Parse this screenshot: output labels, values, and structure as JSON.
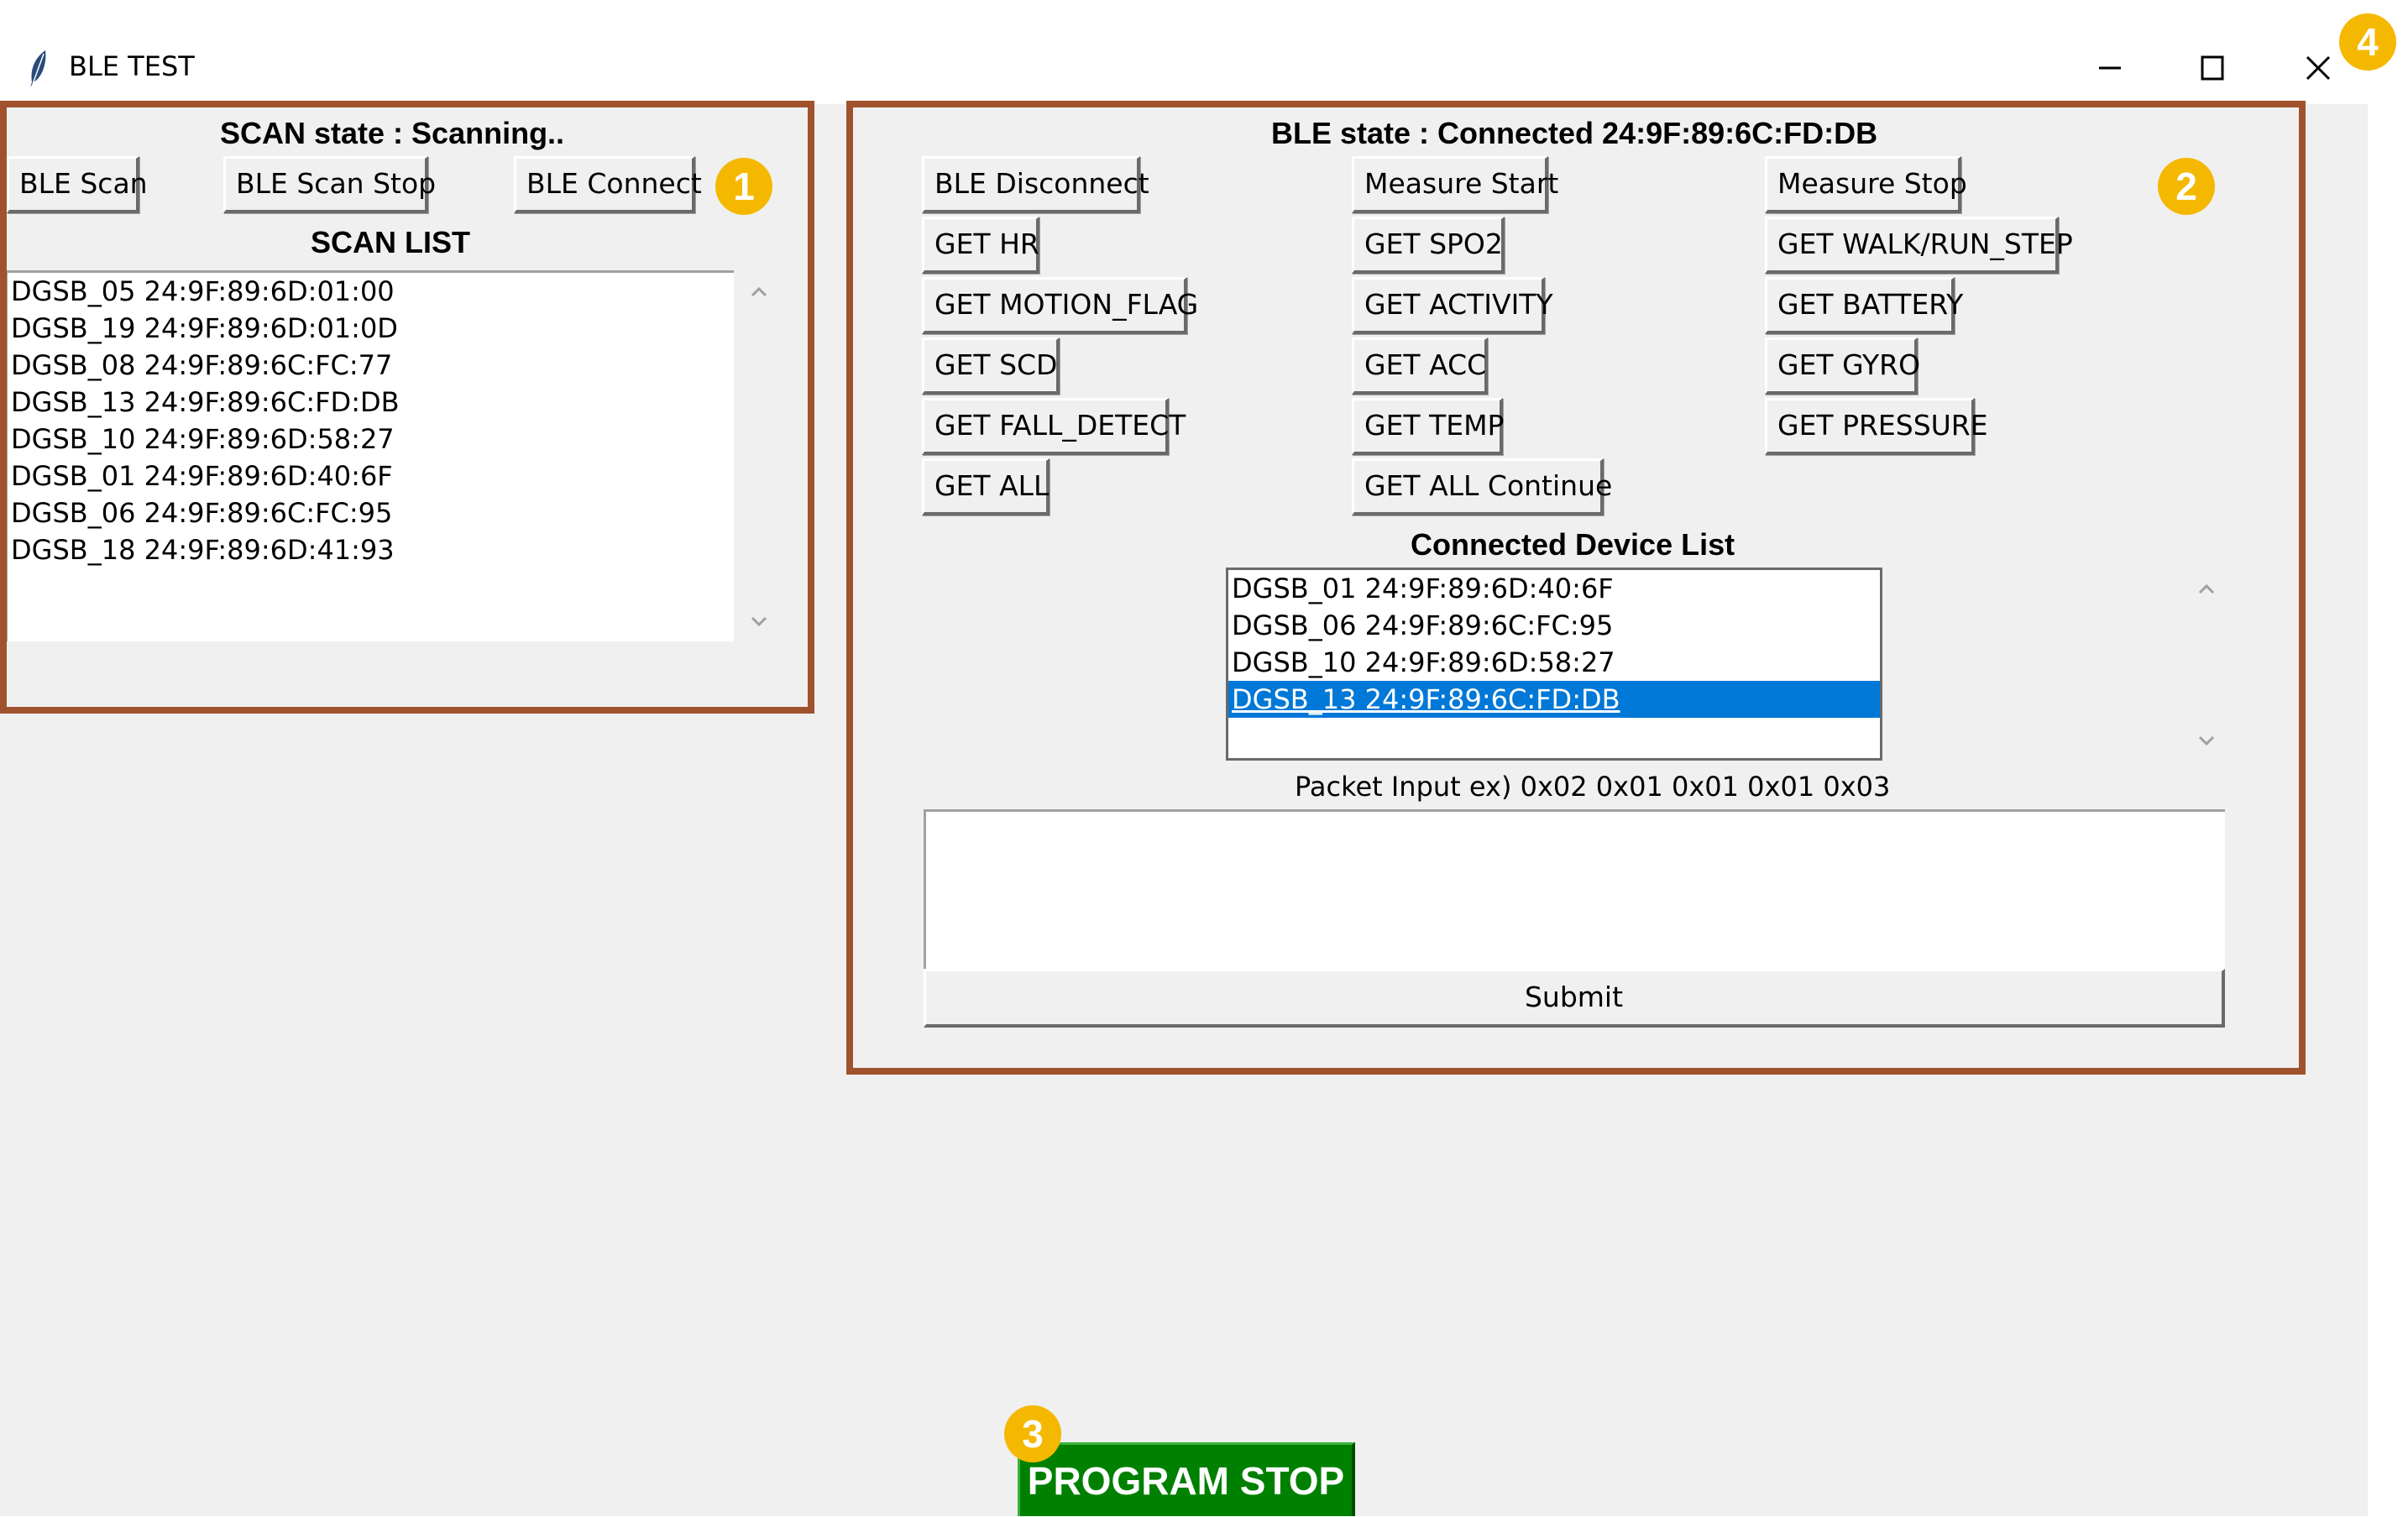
{
  "window": {
    "title": "BLE TEST",
    "icon": "feather-icon",
    "controls": [
      "minimize-icon",
      "maximize-icon",
      "close-icon"
    ]
  },
  "scan_panel": {
    "state_label": "SCAN state : Scanning..",
    "buttons": {
      "scan": "BLE Scan",
      "scan_stop": "BLE Scan Stop",
      "connect": "BLE Connect"
    },
    "list_title": "SCAN LIST",
    "scan_list": [
      "DGSB_05 24:9F:89:6D:01:00",
      "DGSB_19 24:9F:89:6D:01:0D",
      "DGSB_08 24:9F:89:6C:FC:77",
      "DGSB_13 24:9F:89:6C:FD:DB",
      "DGSB_10 24:9F:89:6D:58:27",
      "DGSB_01 24:9F:89:6D:40:6F",
      "DGSB_06 24:9F:89:6C:FC:95",
      "DGSB_18 24:9F:89:6D:41:93"
    ]
  },
  "ble_panel": {
    "state_label": "BLE state :  Connected 24:9F:89:6C:FD:DB",
    "buttons": {
      "disconnect": "BLE Disconnect",
      "measure_start": "Measure Start",
      "measure_stop": "Measure Stop",
      "get_hr": "GET HR",
      "get_spo2": "GET SPO2",
      "get_walk_run_step": "GET WALK/RUN_STEP",
      "get_motion_flag": "GET MOTION_FLAG",
      "get_activity": "GET ACTIVITY",
      "get_battery": "GET BATTERY",
      "get_scd": "GET SCD",
      "get_acc": "GET ACC",
      "get_gyro": "GET GYRO",
      "get_fall_detect": "GET FALL_DETECT",
      "get_temp": "GET TEMP",
      "get_pressure": "GET PRESSURE",
      "get_all": "GET ALL",
      "get_all_continue": "GET ALL Continue"
    },
    "connected_title": "Connected Device List",
    "connected_list": [
      "DGSB_01 24:9F:89:6D:40:6F",
      "DGSB_06 24:9F:89:6C:FC:95",
      "DGSB_10 24:9F:89:6D:58:27",
      "DGSB_13 24:9F:89:6C:FD:DB"
    ],
    "selected_device": "DGSB_13 24:9F:89:6C:FD:DB",
    "packet_label": "Packet Input ex) 0x02 0x01 0x01 0x01 0x03",
    "packet_value": "",
    "submit_label": "Submit"
  },
  "program_stop_label": "PROGRAM STOP",
  "annotations": [
    "1",
    "2",
    "3",
    "4"
  ],
  "colors": {
    "highlight_border": "#a0522d",
    "badge": "#f5b800",
    "selection": "#0078d7",
    "stop_button": "#008000",
    "window_bg": "#f0f0f0"
  }
}
